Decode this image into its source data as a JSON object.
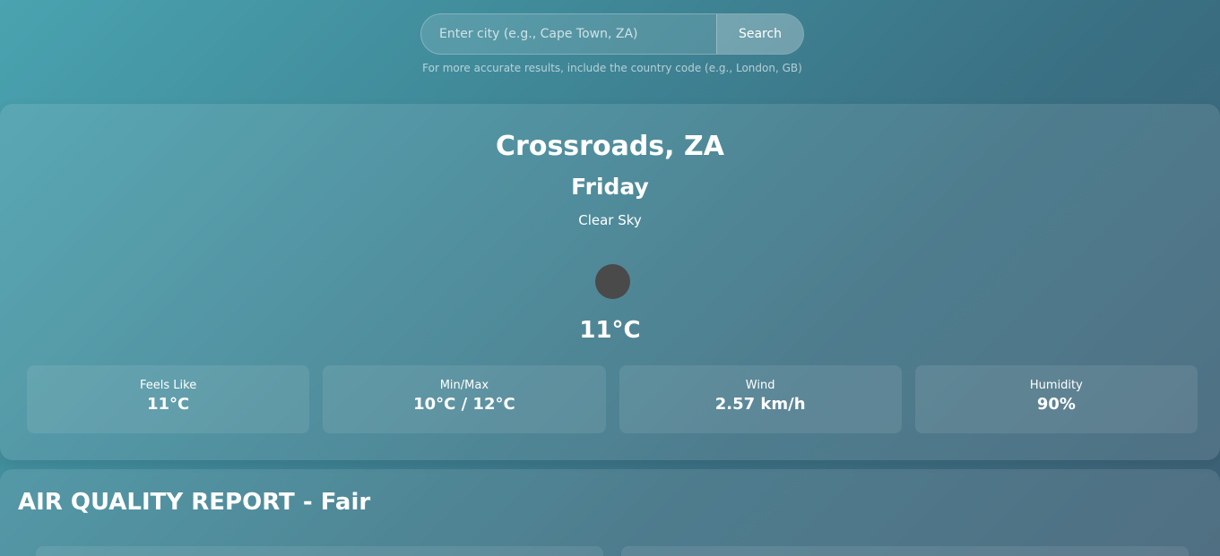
{
  "search": {
    "placeholder": "Enter city (e.g., Cape Town, ZA)",
    "value": "",
    "button_label": "Search",
    "hint": "For more accurate results, include the country code (e.g., London, GB)"
  },
  "weather": {
    "city": "Crossroads, ZA",
    "day": "Friday",
    "condition": "Clear Sky",
    "icon": "weather-icon-placeholder",
    "temperature": "11°C",
    "stats": [
      {
        "label": "Feels Like",
        "value": "11°C"
      },
      {
        "label": "Min/Max",
        "value": "10°C / 12°C"
      },
      {
        "label": "Wind",
        "value": "2.57 km/h"
      },
      {
        "label": "Humidity",
        "value": "90%"
      }
    ]
  },
  "air_quality": {
    "title": "AIR QUALITY REPORT - Fair"
  },
  "colors": {
    "background_start": "#4aa3b0",
    "background_end": "#3d5f74",
    "text": "#ffffff",
    "icon": "#4a4a4a"
  }
}
